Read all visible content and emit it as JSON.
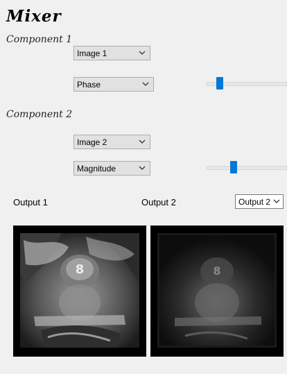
{
  "title": "Mixer",
  "component1": {
    "label": "Component 1",
    "image_select": "Image 1",
    "type_select": "Phase",
    "slider_value": 0.13
  },
  "component2": {
    "label": "Component 2",
    "image_select": "Image 2",
    "type_select": "Magnitude",
    "slider_value": 0.32
  },
  "outputs": {
    "output1_label": "Output 1",
    "output2_label": "Output 2",
    "output_select": "Output 2"
  },
  "colors": {
    "slider_accent": "#0078d7",
    "frame_bg": "#000000"
  }
}
